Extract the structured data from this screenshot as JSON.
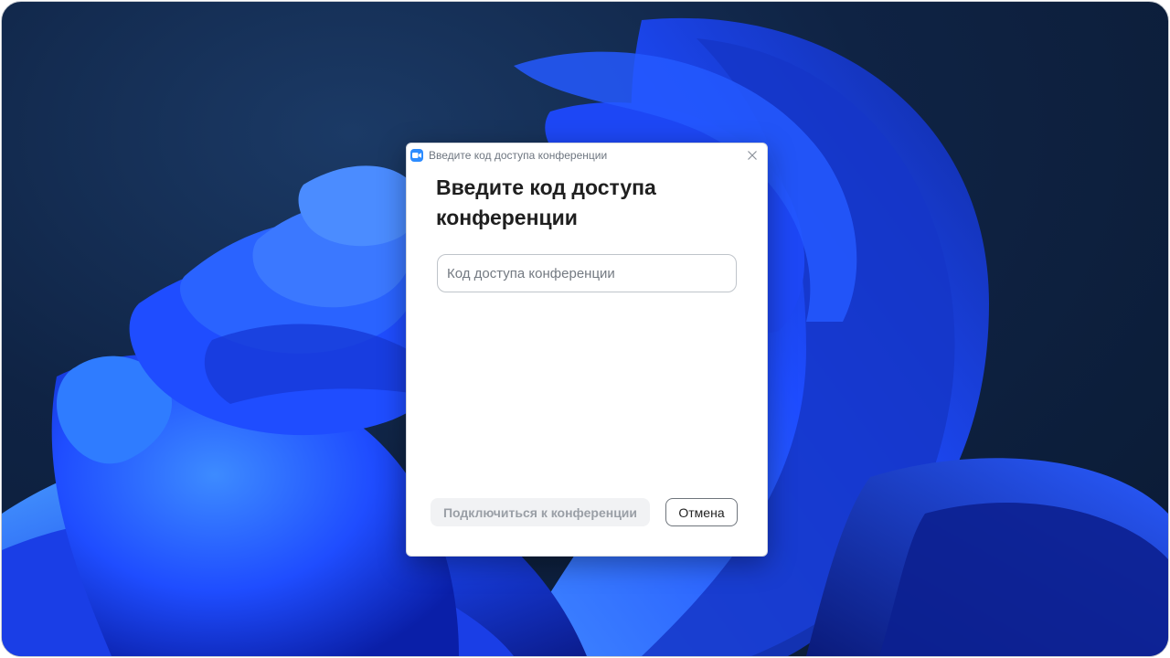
{
  "window": {
    "title": "Введите код доступа конференции"
  },
  "dialog": {
    "heading": "Введите код доступа конференции",
    "code_input": {
      "value": "",
      "placeholder": "Код доступа конференции"
    },
    "join_button_label": "Подключиться к конференции",
    "cancel_button_label": "Отмена"
  },
  "icons": {
    "app": "zoom-camera-icon",
    "close": "close-icon"
  },
  "colors": {
    "accent": "#2d8cff",
    "disabled_button_bg": "#f1f2f4",
    "disabled_button_text": "#9a9fa6"
  }
}
